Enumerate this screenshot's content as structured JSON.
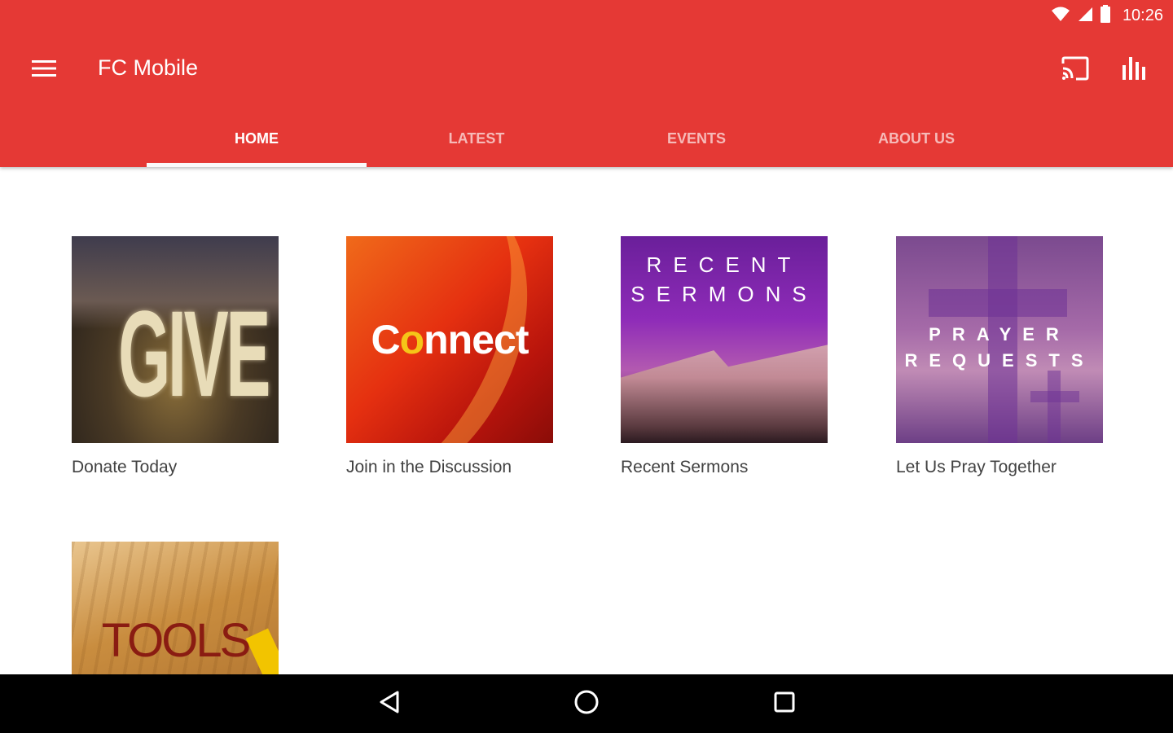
{
  "status": {
    "time": "10:26"
  },
  "toolbar": {
    "title": "FC Mobile"
  },
  "tabs": [
    {
      "label": "HOME",
      "active": true
    },
    {
      "label": "LATEST",
      "active": false
    },
    {
      "label": "EVENTS",
      "active": false
    },
    {
      "label": "ABOUT US",
      "active": false
    }
  ],
  "cards": [
    {
      "caption": "Donate Today",
      "image_text": "GIVE"
    },
    {
      "caption": "Join in the Discussion",
      "image_text_pre": "C",
      "image_text_o": "o",
      "image_text_post": "nnect"
    },
    {
      "caption": "Recent Sermons",
      "image_line1": "RECENT",
      "image_line2": "SERMONS"
    },
    {
      "caption": "Let Us Pray Together",
      "image_line1": "PRAYER",
      "image_line2": "REQUESTS"
    },
    {
      "caption": "",
      "image_text": "TOOLS"
    }
  ],
  "colors": {
    "app_bar": "#e53935",
    "tab_indicator": "#fafafa",
    "nav_bar": "#000000"
  },
  "icons": {
    "menu": "hamburger-menu-icon",
    "cast": "cast-icon",
    "stats": "bar-chart-icon",
    "back": "back-triangle-icon",
    "home": "home-circle-icon",
    "recents": "recents-square-icon",
    "wifi": "wifi-icon",
    "signal": "signal-icon",
    "battery": "battery-icon"
  }
}
